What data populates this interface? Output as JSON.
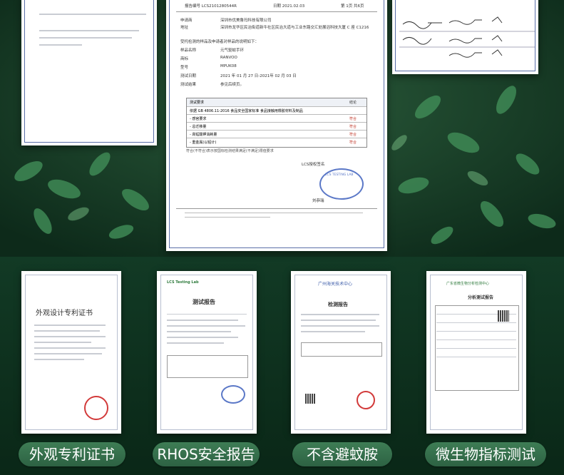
{
  "main_report": {
    "header_left": "报告编号 LCS2101280544R",
    "header_mid": "日期 2021.02.03",
    "header_right": "第 1页 共6页",
    "rows": [
      {
        "k": "申请商",
        "v": "深圳市优美鲁玛科技有限公司"
      },
      {
        "k": "地址",
        "v": "深圳市龙华区民治街道新牛社区民治大道与工业东路交汇处展滔科技大厦 C 座 C1216"
      },
      {
        "k": "受托检测的样品及申请者对样品的说明如下：",
        "v": ""
      },
      {
        "k": "样品名称",
        "v": "元气驱蚊手环"
      },
      {
        "k": "商标",
        "v": "RANVOO"
      },
      {
        "k": "型号",
        "v": "MPUK08"
      },
      {
        "k": "测试日期",
        "v": "2021 年 01 月 27 日-2021年 02 月 03 日"
      },
      {
        "k": "测试结果",
        "v": "参见后续页。"
      }
    ],
    "table_header_left": "测试要求",
    "table_header_right": "结论",
    "table_rows": [
      {
        "item": "依据 GB 4806.11-2016 食品安全国家标准 食品接触用橡胶材料及制品",
        "result": ""
      },
      {
        "item": "- 感官要求",
        "result": "符合"
      },
      {
        "item": "- 总迁移量",
        "result": "符合"
      },
      {
        "item": "- 高锰酸钾消耗量",
        "result": "符合"
      },
      {
        "item": "- 重金属(以铅计)",
        "result": "符合"
      }
    ],
    "note": "符合(不符合)表示按国标检测结果满足(不满足)限值要求",
    "signed_by": "LCS授权签名",
    "stamp_text": "LCS TESTING LAB",
    "signer": "刘恭瑞"
  },
  "certificates": [
    {
      "title": "外观设计专利证书",
      "label": "外观专利证书"
    },
    {
      "title": "测试报告",
      "brand": "LCS Testing Lab",
      "label": "RHOS安全报告"
    },
    {
      "title": "检测报告",
      "brand": "广州海关技术中心",
      "label": "不含避蚊胺"
    },
    {
      "title": "分析测试报告",
      "brand": "广东省微生物分析检测中心",
      "label": "微生物指标测试"
    }
  ]
}
